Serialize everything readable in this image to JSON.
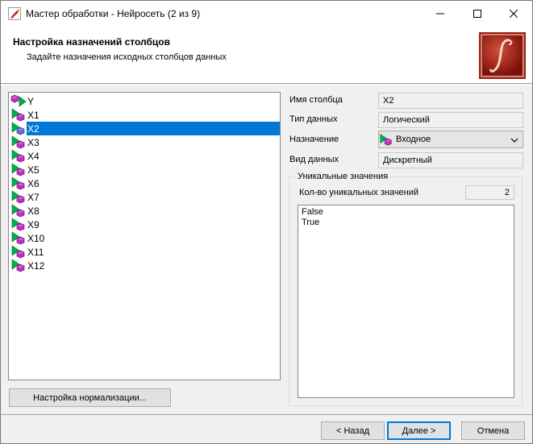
{
  "window": {
    "title": "Мастер обработки - Нейросеть (2 из 9)"
  },
  "header": {
    "title": "Настройка назначений столбцов",
    "subtitle": "Задайте назначения исходных столбцов данных"
  },
  "tree": {
    "items": [
      {
        "label": "Y",
        "role": "output"
      },
      {
        "label": "X1",
        "role": "input"
      },
      {
        "label": "X2",
        "role": "input",
        "selected": true
      },
      {
        "label": "X3",
        "role": "input"
      },
      {
        "label": "X4",
        "role": "input"
      },
      {
        "label": "X5",
        "role": "input"
      },
      {
        "label": "X6",
        "role": "input"
      },
      {
        "label": "X7",
        "role": "input"
      },
      {
        "label": "X8",
        "role": "input"
      },
      {
        "label": "X9",
        "role": "input"
      },
      {
        "label": "X10",
        "role": "input"
      },
      {
        "label": "X11",
        "role": "input"
      },
      {
        "label": "X12",
        "role": "input"
      }
    ]
  },
  "details": {
    "column_name_label": "Имя столбца",
    "column_name_value": "X2",
    "data_type_label": "Тип данных",
    "data_type_value": "Логический",
    "purpose_label": "Назначение",
    "purpose_value": "Входное",
    "data_kind_label": "Вид данных",
    "data_kind_value": "Дискретный"
  },
  "unique": {
    "group_title": "Уникальные значения",
    "count_label": "Кол-во уникальных значений",
    "count_value": "2",
    "values": [
      "False",
      "True"
    ]
  },
  "buttons": {
    "normalization": "Настройка нормализации...",
    "back": "< Назад",
    "next": "Далее >",
    "cancel": "Отмена"
  },
  "colors": {
    "selection": "#0078d7",
    "logo_bg": "#9c1c10",
    "input_arrow": "#00b050",
    "cube": "#a020a0"
  }
}
